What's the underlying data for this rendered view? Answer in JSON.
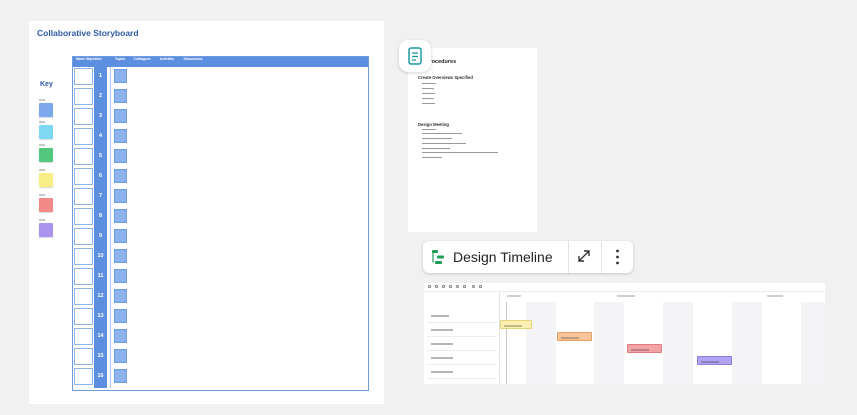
{
  "storyboard": {
    "title": "Collaborative Storyboard",
    "key_title": "Key",
    "key_colors": [
      "#7ea8ec",
      "#7fd8f2",
      "#52c77e",
      "#f7ef86",
      "#f28a8a",
      "#a993ec"
    ],
    "header": [
      "Name\nObjectives",
      "Topics",
      "Colleagues",
      "Activities",
      "Discussions"
    ],
    "rows": [
      "1",
      "2",
      "3",
      "4",
      "5",
      "6",
      "7",
      "8",
      "9",
      "10",
      "11",
      "12",
      "13",
      "14",
      "15",
      "16"
    ]
  },
  "document": {
    "title": "n Procedures",
    "section1": "Create Overviews Specified",
    "section2": "Design Meeting"
  },
  "timeline": {
    "title": "Design Timeline",
    "icon": "timeline-icon",
    "expand_icon": "expand-icon",
    "more_icon": "more-vertical-icon",
    "bars": [
      {
        "color": "#fbefb1",
        "border": "#e7d47a"
      },
      {
        "color": "#f8c49a",
        "border": "#e9a05e"
      },
      {
        "color": "#f4a3a6",
        "border": "#e27a80"
      },
      {
        "color": "#b3a3f2",
        "border": "#8e7ce0"
      }
    ]
  }
}
